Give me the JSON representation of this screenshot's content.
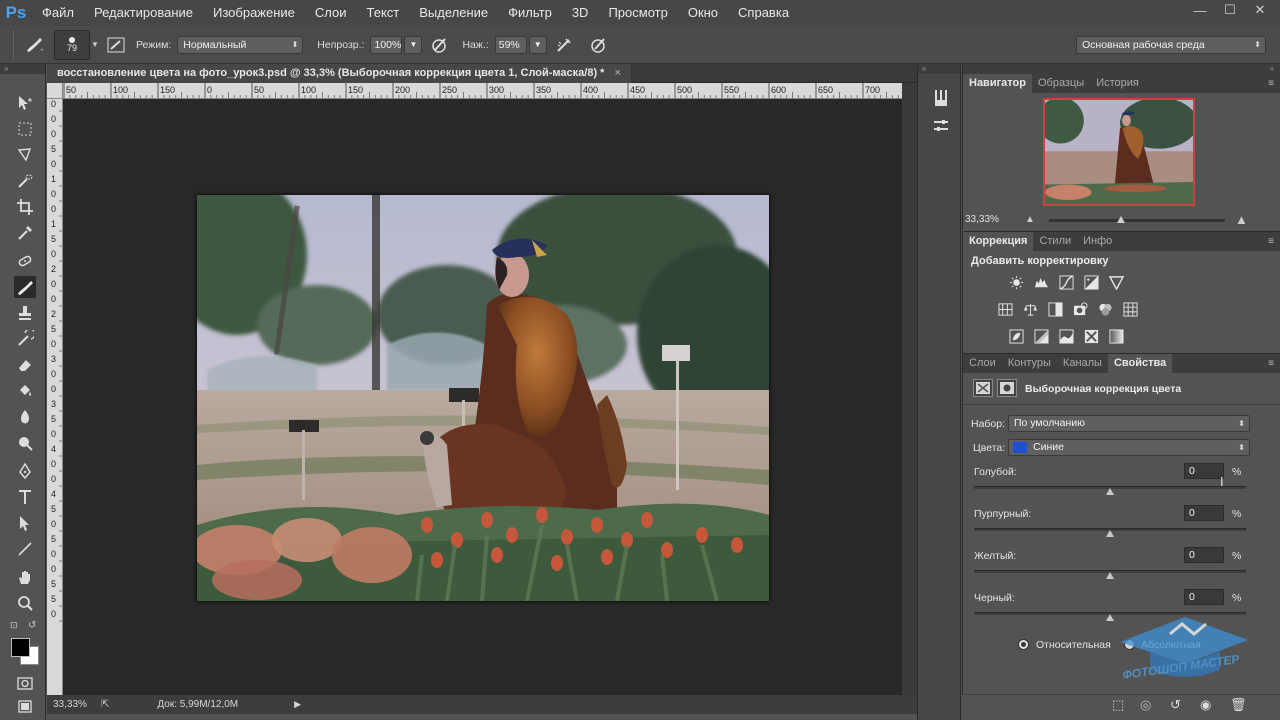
{
  "app": {
    "logo": "Ps"
  },
  "menu": [
    "Файл",
    "Редактирование",
    "Изображение",
    "Слои",
    "Текст",
    "Выделение",
    "Фильтр",
    "3D",
    "Просмотр",
    "Окно",
    "Справка"
  ],
  "window_controls": {
    "minimize": "—",
    "maximize": "☐",
    "close": "✕"
  },
  "options": {
    "brush_size": "79",
    "mode_label": "Режим:",
    "mode_value": "Нормальный",
    "opacity_label": "Непрозр.:",
    "opacity_value": "100%",
    "pressure_label": "Наж.:",
    "pressure_value": "59%",
    "workspace": "Основная рабочая среда"
  },
  "document": {
    "tab_title": "восстановление цвета на фото_урок3.psd @ 33,3% (Выборочная коррекция цвета 1, Слой-маска/8) *",
    "close": "×",
    "ruler_h": [
      "50",
      "100",
      "150",
      "0",
      "50",
      "100",
      "150",
      "200",
      "250",
      "300",
      "350",
      "400",
      "450",
      "500",
      "550",
      "600",
      "650",
      "700"
    ],
    "ruler_v": [
      "0",
      "0",
      "0",
      "5",
      "0",
      "1",
      "0",
      "0",
      "1",
      "5",
      "0",
      "2",
      "0",
      "0",
      "2",
      "5",
      "0",
      "3",
      "0",
      "0",
      "3",
      "5",
      "0",
      "4",
      "0",
      "0",
      "4",
      "5",
      "0",
      "5",
      "0",
      "0",
      "5",
      "5",
      "0"
    ],
    "zoom": "33,33%",
    "doc_info": "Док: 5,99M/12,0M"
  },
  "navigator": {
    "tabs": [
      "Навигатор",
      "Образцы",
      "История"
    ],
    "zoom": "33,33%"
  },
  "correction": {
    "tabs": [
      "Коррекция",
      "Стили",
      "Инфо"
    ],
    "title": "Добавить корректировку"
  },
  "properties": {
    "tabs": [
      "Слои",
      "Контуры",
      "Каналы",
      "Свойства"
    ],
    "title": "Выборочная коррекция цвета",
    "preset_label": "Набор:",
    "preset_value": "По умолчанию",
    "colors_label": "Цвета:",
    "colors_value": "Синие",
    "colors_swatch": "#1f4fd6",
    "sliders": [
      {
        "label": "Голубой:",
        "value": "0",
        "unit": "%"
      },
      {
        "label": "Пурпурный:",
        "value": "0",
        "unit": "%"
      },
      {
        "label": "Желтый:",
        "value": "0",
        "unit": "%"
      },
      {
        "label": "Черный:",
        "value": "0",
        "unit": "%"
      }
    ],
    "relative_label": "Относительная",
    "absolute_label": "Абсолютная",
    "method": "relative"
  },
  "watermark": {
    "text": "ФОТОШОП МАСТЕР"
  },
  "colors": {
    "accent": "#4aa3f0",
    "foreground": "#000000",
    "background": "#ffffff"
  }
}
